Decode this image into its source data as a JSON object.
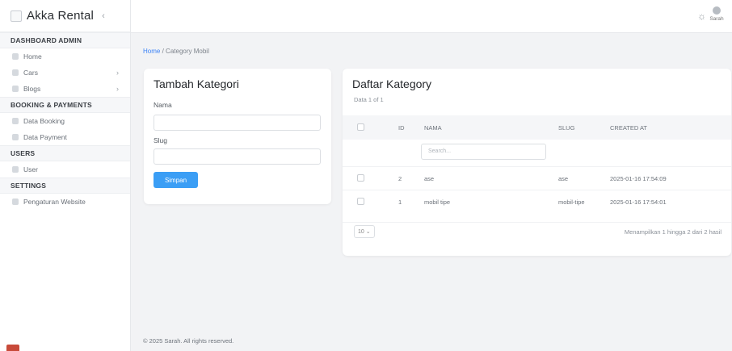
{
  "app": {
    "brand": "Akka Rental",
    "collapse_icon": "chevron-left-icon"
  },
  "sidebar": {
    "sections": [
      {
        "title": "DASHBOARD ADMIN",
        "items": [
          {
            "label": "Home",
            "icon": "home-icon",
            "has_arrow": false
          },
          {
            "label": "Cars",
            "icon": "car-icon",
            "has_arrow": true
          },
          {
            "label": "Blogs",
            "icon": "blog-icon",
            "has_arrow": true
          }
        ]
      },
      {
        "title": "BOOKING & PAYMENTS",
        "items": [
          {
            "label": "Data Booking",
            "icon": "booking-icon",
            "has_arrow": false
          },
          {
            "label": "Data Payment",
            "icon": "payment-icon",
            "has_arrow": false
          }
        ]
      },
      {
        "title": "USERS",
        "items": [
          {
            "label": "User",
            "icon": "user-icon",
            "has_arrow": false
          }
        ]
      },
      {
        "title": "SETTINGS",
        "items": [
          {
            "label": "Pengaturan Website",
            "icon": "settings-icon",
            "has_arrow": false
          }
        ]
      }
    ]
  },
  "topbar": {
    "user_name": "Sarah"
  },
  "breadcrumb": {
    "home": "Home",
    "separator": "/",
    "current": "Category Mobil"
  },
  "form": {
    "title": "Tambah Kategori",
    "name_label": "Nama",
    "name_value": "",
    "slug_label": "Slug",
    "slug_value": "",
    "submit_label": "Simpan"
  },
  "list": {
    "title": "Daftar Kategory",
    "subtitle": "Data 1 of 1",
    "columns": [
      "ID",
      "NAMA",
      "SLUG",
      "CREATED AT"
    ],
    "search_placeholder": "Search...",
    "rows": [
      {
        "id": "2",
        "nama": "ase",
        "slug": "ase",
        "created_at": "2025-01-16 17:54:09"
      },
      {
        "id": "1",
        "nama": "mobil tipe",
        "slug": "mobil-tipe",
        "created_at": "2025-01-16 17:54:01"
      }
    ],
    "per_page": "10",
    "showing": "Menampilkan 1 hingga 2 dari 2 hasil"
  },
  "footer": {
    "text": "© 2025 Sarah. All rights reserved."
  },
  "colors": {
    "accent": "#3b9ef5",
    "link": "#3b82f6",
    "background": "#f2f3f5"
  }
}
